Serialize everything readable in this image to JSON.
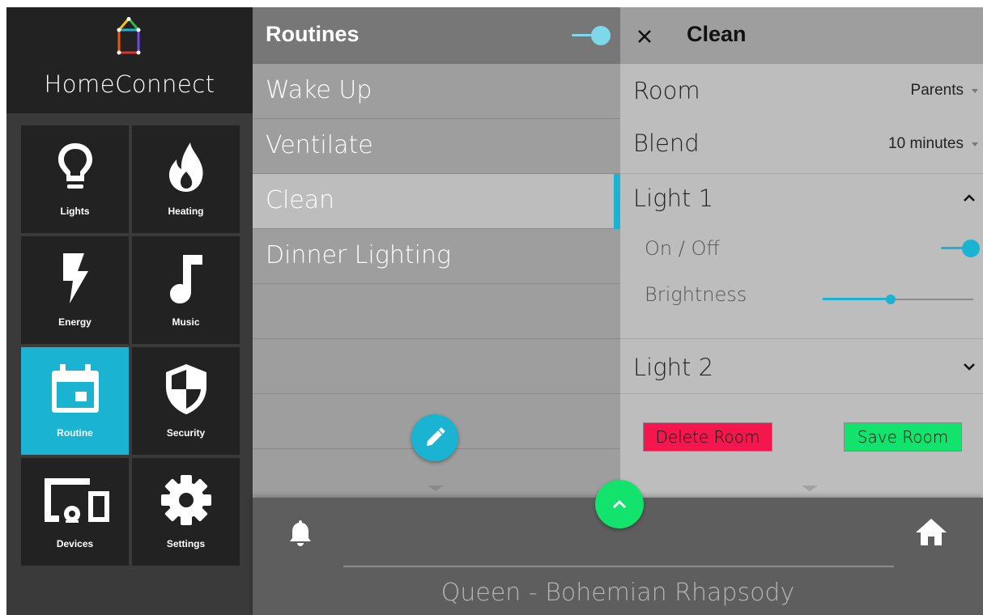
{
  "app": {
    "brand": "HomeConnect"
  },
  "colors": {
    "accent": "#1ab3d1",
    "sidebar": "#222222",
    "success": "#11e36d",
    "danger": "#f5164e"
  },
  "nav": [
    {
      "label": "Lights",
      "icon": "lightbulb-icon"
    },
    {
      "label": "Heating",
      "icon": "flame-icon"
    },
    {
      "label": "Energy",
      "icon": "lightning-icon"
    },
    {
      "label": "Music",
      "icon": "music-note-icon"
    },
    {
      "label": "Routine",
      "icon": "calendar-icon",
      "active": true
    },
    {
      "label": "Security",
      "icon": "shield-icon"
    },
    {
      "label": "Devices",
      "icon": "devices-icon"
    },
    {
      "label": "Settings",
      "icon": "gear-icon"
    }
  ],
  "routines": {
    "title": "Routines",
    "toggle_on": true,
    "items": [
      "Wake Up",
      "Ventilate",
      "Clean",
      "Dinner Lighting"
    ],
    "selected": "Clean"
  },
  "detail": {
    "title": "Clean",
    "room_label": "Room",
    "room_value": "Parents",
    "blend_label": "Blend",
    "blend_value": "10 minutes",
    "light1": {
      "label": "Light 1",
      "expanded": true,
      "onoff_label": "On / Off",
      "on": true,
      "brightness_label": "Brightness",
      "brightness": 0.45
    },
    "light2": {
      "label": "Light 2",
      "expanded": false
    },
    "delete_label": "Delete Room",
    "save_label": "Save Room"
  },
  "player": {
    "now_playing": "Queen - Bohemian Rhapsody"
  }
}
